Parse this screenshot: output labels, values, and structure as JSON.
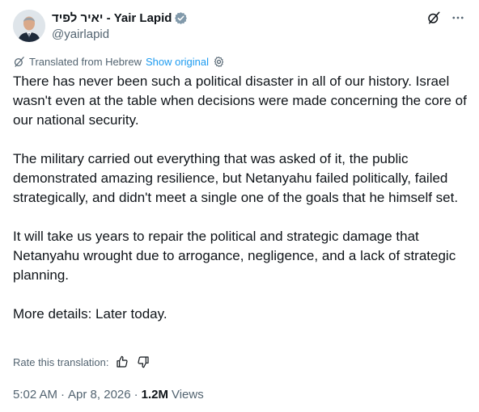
{
  "author": {
    "display_name": "יאיר לפיד - Yair Lapid",
    "handle": "@yairlapid",
    "verified": true,
    "avatar_icon": "profile-photo-man-suit"
  },
  "translation": {
    "label": "Translated from Hebrew",
    "show_original": "Show original",
    "rate_label": "Rate this translation:"
  },
  "tweet": {
    "paragraphs": [
      "There has never been such a political disaster in all of our history. Israel wasn't even at the table when decisions were made concerning the core of our national security.",
      "The military carried out everything that was asked of it, the public demonstrated amazing resilience, but Netanyahu failed politically, failed strategically, and didn't meet a single one of the goals that he himself set.",
      "It will take us years to repair the political and strategic damage that Netanyahu wrought due to arrogance, negligence, and a lack of strategic planning.",
      "More details: Later today."
    ]
  },
  "meta": {
    "time": "5:02 AM",
    "date": "Apr 8, 2026",
    "separator": "·",
    "views_count": "1.2M",
    "views_label": "Views"
  },
  "colors": {
    "text": "#0f1419",
    "secondary": "#536471",
    "link": "#1d9bf0",
    "verified_badge": "#829aab"
  }
}
